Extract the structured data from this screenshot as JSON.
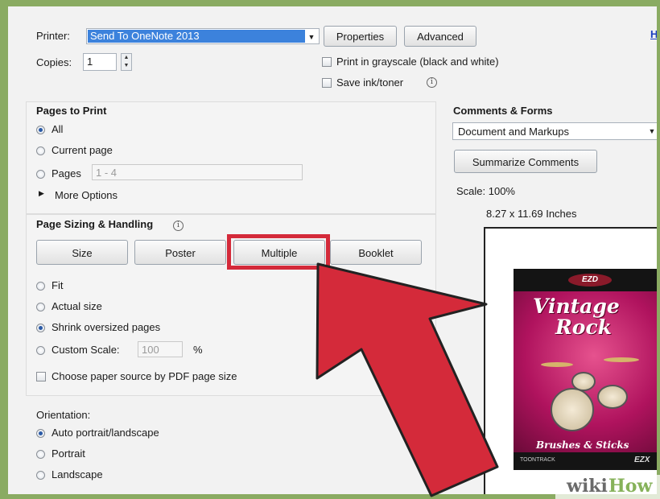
{
  "printer": {
    "label": "Printer:",
    "selected": "Send To OneNote 2013",
    "properties_label": "Properties",
    "advanced_label": "Advanced",
    "help_link": "H"
  },
  "copies": {
    "label": "Copies:",
    "value": "1"
  },
  "options": {
    "grayscale_label": "Print in grayscale (black and white)",
    "save_ink_label": "Save ink/toner",
    "grayscale_checked": false,
    "save_ink_checked": false
  },
  "pages_to_print": {
    "title": "Pages to Print",
    "all_label": "All",
    "current_label": "Current page",
    "pages_label": "Pages",
    "pages_value": "1 - 4",
    "more_options_label": "More Options",
    "selected": "All"
  },
  "page_sizing": {
    "title": "Page Sizing & Handling",
    "buttons": [
      "Size",
      "Poster",
      "Multiple",
      "Booklet"
    ],
    "highlighted_button": "Multiple",
    "highlight_color": "#d42a3a",
    "fit_label": "Fit",
    "actual_label": "Actual size",
    "shrink_label": "Shrink oversized pages",
    "custom_label": "Custom Scale:",
    "custom_value": "100",
    "percent": "%",
    "paper_source_label": "Choose paper source by PDF page size",
    "selected": "Shrink oversized pages"
  },
  "orientation": {
    "title": "Orientation:",
    "auto_label": "Auto portrait/landscape",
    "portrait_label": "Portrait",
    "landscape_label": "Landscape",
    "selected": "Auto portrait/landscape"
  },
  "comments_forms": {
    "title": "Comments & Forms",
    "selected": "Document and Markups",
    "summarize_label": "Summarize Comments"
  },
  "preview": {
    "scale_label": "Scale: 100%",
    "size_label": "8.27 x 11.69 Inches",
    "cover_brand": "EZD",
    "cover_title_line1": "Vintage",
    "cover_title_line2": "Rock",
    "cover_subtitle": "Brushes & Sticks",
    "cover_footer_left": "TOONTRACK",
    "cover_footer_right": "EZX"
  },
  "watermark": {
    "prefix": "wiki",
    "suffix": "How"
  },
  "colors": {
    "arrow": "#d42a3a",
    "selection": "#3c82dc",
    "cover_magenta": "#b0135e"
  }
}
